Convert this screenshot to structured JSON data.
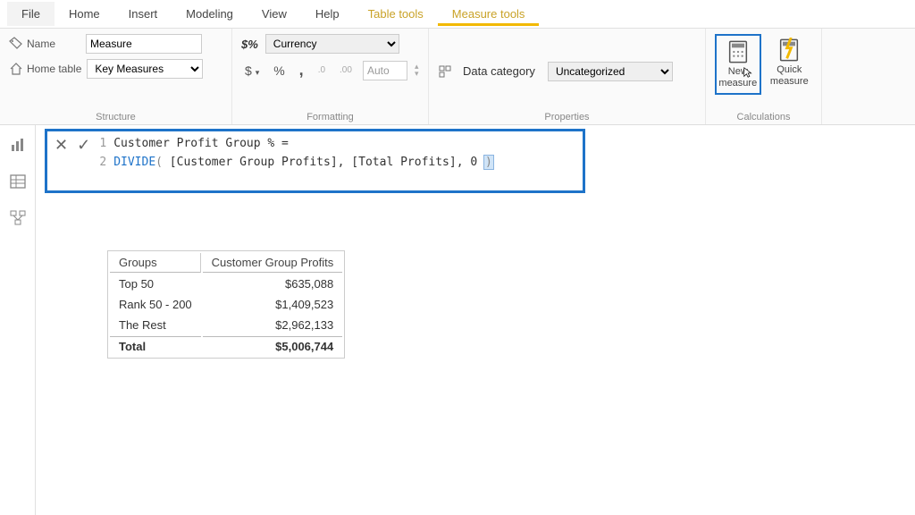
{
  "tabs": {
    "file": "File",
    "home": "Home",
    "insert": "Insert",
    "modeling": "Modeling",
    "view": "View",
    "help": "Help",
    "table_tools": "Table tools",
    "measure_tools": "Measure tools"
  },
  "structure": {
    "group_label": "Structure",
    "name_label": "Name",
    "name_value": "Measure",
    "home_table_label": "Home table",
    "home_table_value": "Key Measures"
  },
  "formatting": {
    "group_label": "Formatting",
    "format_prefix": "$%",
    "format_value": "Currency",
    "currency_btn": "$",
    "percent_btn": "%",
    "comma_btn": ",",
    "dec_add": ".0",
    "dec_sub": ".00",
    "auto_value": "Auto"
  },
  "properties": {
    "group_label": "Properties",
    "category_label": "Data category",
    "category_value": "Uncategorized"
  },
  "calculations": {
    "group_label": "Calculations",
    "new_measure_l1": "New",
    "new_measure_l2": "measure",
    "quick_measure_l1": "Quick",
    "quick_measure_l2": "measure"
  },
  "formula": {
    "line1_no": "1",
    "line1_text": "Customer Profit Group % =",
    "line2_no": "2",
    "line2_func": "DIVIDE",
    "line2_open": "(",
    "line2_arg1": " [Customer Group Profits], [Total Profits], 0 ",
    "line2_close": ")"
  },
  "table": {
    "col1": "Groups",
    "col2": "Customer Group Profits",
    "rows": [
      {
        "group": "Top 50",
        "value": "$635,088"
      },
      {
        "group": "Rank 50 - 200",
        "value": "$1,409,523"
      },
      {
        "group": "The Rest",
        "value": "$2,962,133"
      }
    ],
    "total_label": "Total",
    "total_value": "$5,006,744"
  }
}
